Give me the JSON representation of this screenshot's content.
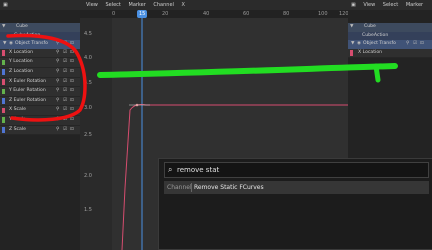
{
  "header": {
    "menus": [
      "View",
      "Select",
      "Marker",
      "Channel"
    ],
    "close_glyph": "X"
  },
  "channels": {
    "object": "Cube",
    "action": "CubeAction",
    "group": "Object Transfo",
    "curves": [
      {
        "label": "X Location",
        "color": "#d64d6f"
      },
      {
        "label": "Y Location",
        "color": "#63b14c"
      },
      {
        "label": "Z Location",
        "color": "#4f74d1"
      },
      {
        "label": "X Euler Rotation",
        "color": "#d64d6f"
      },
      {
        "label": "Y Euler Rotation",
        "color": "#63b14c"
      },
      {
        "label": "Z Euler Rotation",
        "color": "#4f74d1"
      },
      {
        "label": "X Scale",
        "color": "#d64d6f"
      },
      {
        "label": "Y Scale",
        "color": "#63b14c"
      },
      {
        "label": "Z Scale",
        "color": "#4f74d1"
      }
    ]
  },
  "graph": {
    "frame_ticks": [
      "0",
      "20",
      "40",
      "60",
      "80",
      "100",
      "120"
    ],
    "current_frame": "15",
    "y_ticks": [
      "4.5",
      "4.0",
      "3.5",
      "3.0",
      "2.5",
      "2.0",
      "1.5"
    ]
  },
  "search": {
    "query": "remove stat",
    "result_category": "Channel",
    "result_label": "Remove Static FCurves"
  },
  "right_panel": {
    "object": "Cube",
    "action": "CubeAction",
    "group": "Object Transfo",
    "curve": "X Location",
    "curve_color": "#d64d6f"
  },
  "colors": {
    "annotation_red": "#ee1111",
    "annotation_green": "#22dd22",
    "playhead": "#4a90e2",
    "curve": "#d64d6f"
  }
}
